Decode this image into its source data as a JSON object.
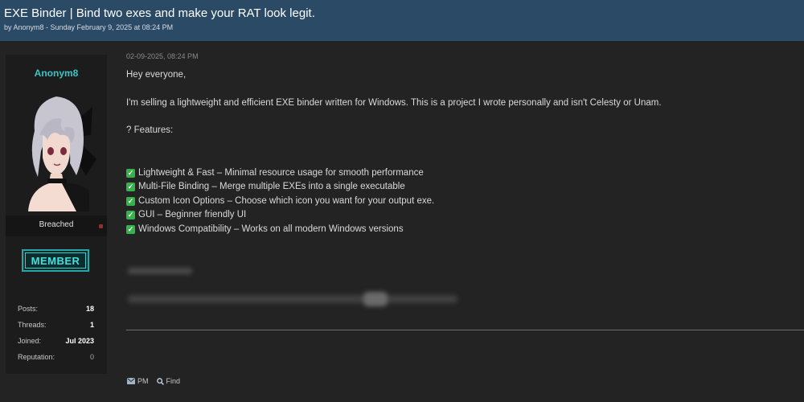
{
  "thread": {
    "title": "EXE Binder | Bind two exes and make your RAT look legit.",
    "meta": "by Anonym8 - Sunday February 9, 2025 at 08:24 PM"
  },
  "author": {
    "name": "Anonym8",
    "avatar_icon": "anime-avatar",
    "rank": "Breached",
    "badge": "MEMBER",
    "stats": [
      {
        "label": "Posts:",
        "value": "18"
      },
      {
        "label": "Threads:",
        "value": "1"
      },
      {
        "label": "Joined:",
        "value": "Jul 2023"
      },
      {
        "label": "Reputation:",
        "value": "0"
      }
    ]
  },
  "post": {
    "date": "02-09-2025, 08:24 PM",
    "greeting": "Hey everyone,",
    "intro": "I'm selling a lightweight and efficient EXE binder written for Windows. This is a project I wrote personally and isn't Celesty or Unam.",
    "features_heading": "? Features:",
    "features": [
      "Lightweight & Fast – Minimal resource usage for smooth performance",
      "Multi-File Binding – Merge multiple EXEs into a single executable",
      "Custom Icon Options – Choose which icon you want for your output exe.",
      "GUI – Beginner friendly UI",
      "Windows Compatibility – Works on all modern Windows versions"
    ],
    "check_icon": "check-mark-icon"
  },
  "actions": {
    "pm": "PM",
    "find": "Find"
  },
  "colors": {
    "header_bg": "#2b4a65",
    "accent": "#33c7c7",
    "check": "#34b34a"
  }
}
